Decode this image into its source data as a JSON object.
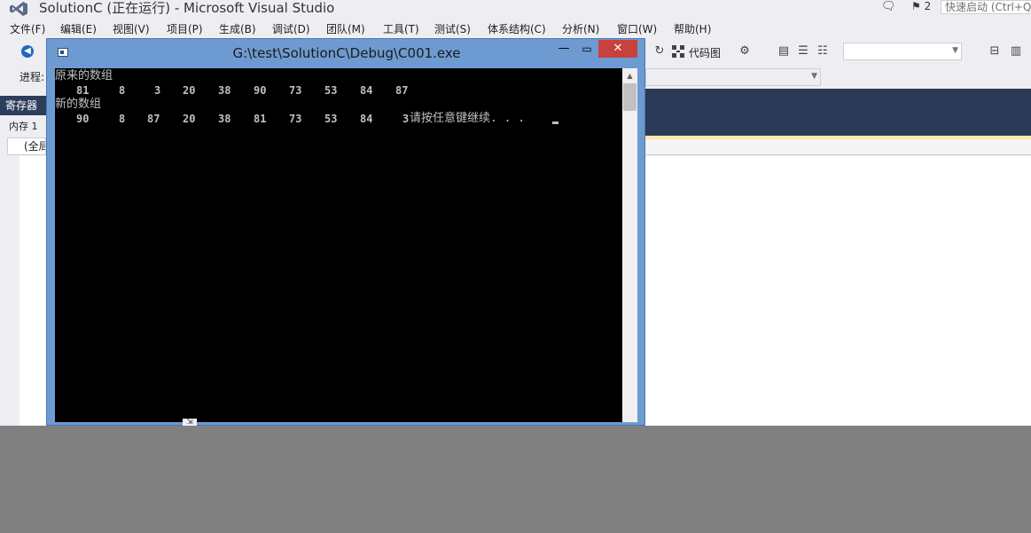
{
  "vs": {
    "title": "SolutionC (正在运行) - Microsoft Visual Studio",
    "notification_count": "2",
    "quick_launch_placeholder": "快速启动 (Ctrl+Q)",
    "menu": [
      "文件(F)",
      "编辑(E)",
      "视图(V)",
      "项目(P)",
      "生成(B)",
      "调试(D)",
      "团队(M)",
      "工具(T)",
      "测试(S)",
      "体系结构(C)",
      "分析(N)",
      "窗口(W)",
      "帮助(H)"
    ],
    "toolbar": {
      "code_map_label": "代码图"
    },
    "process_label": "进程:",
    "registers_tab": "寄存器",
    "memory_tab": "内存 1",
    "scope_value": "(全局"
  },
  "console": {
    "title": "G:\\test\\SolutionC\\Debug\\C001.exe",
    "lines": {
      "original_label": "原来的数组",
      "new_label": "新的数组",
      "prompt": "请按任意键继续. . ."
    },
    "original_array": [
      "81",
      "8",
      "3",
      "20",
      "38",
      "90",
      "73",
      "53",
      "84",
      "87"
    ],
    "new_array": [
      "90",
      "8",
      "87",
      "20",
      "38",
      "81",
      "73",
      "53",
      "84",
      "3"
    ]
  },
  "colors": {
    "accent_blue": "#1e6bbf",
    "close_red": "#c7413d",
    "console_frame": "#6d9bd1",
    "editor_header": "#2b3a56"
  }
}
